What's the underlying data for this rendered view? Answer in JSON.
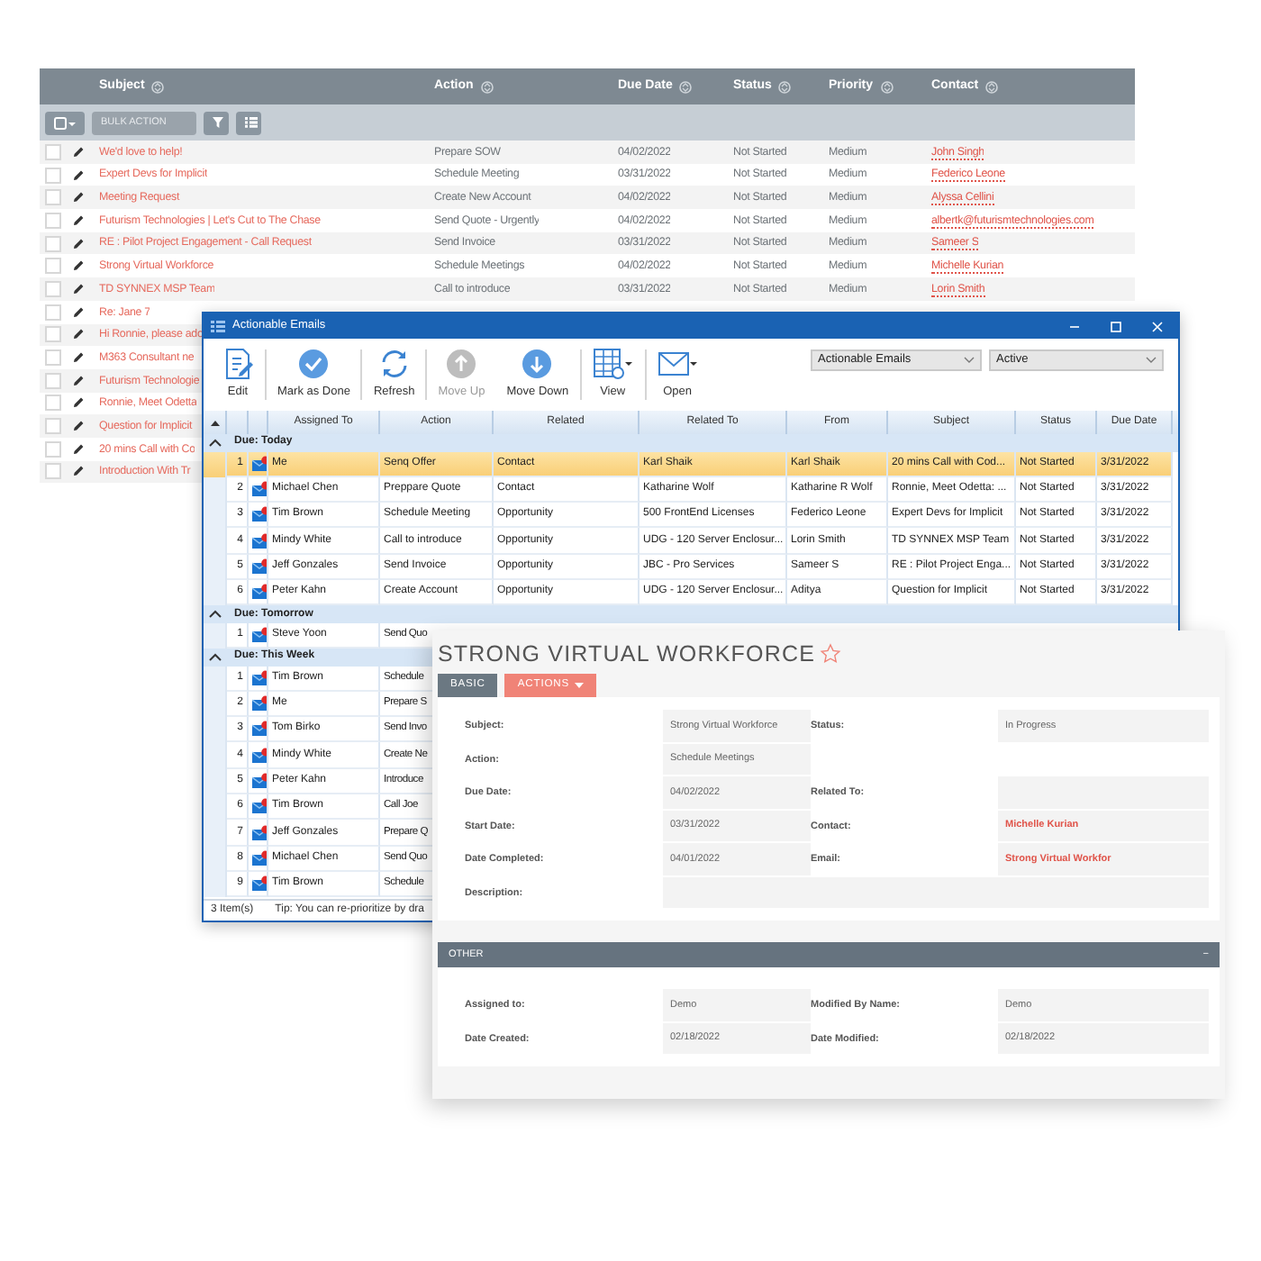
{
  "task_list": {
    "columns": [
      "Subject",
      "Action",
      "Due Date",
      "Status",
      "Priority",
      "Contact"
    ],
    "toolbar": {
      "bulk_action": "BULK ACTION",
      "bulk_disabled": true
    },
    "rows": [
      {
        "checked": false,
        "subject": "We'd love to help!",
        "action": "Prepare SOW",
        "due_date": "04/02/2022",
        "status": "Not Started",
        "priority": "Medium",
        "contact": "John Singh"
      },
      {
        "checked": false,
        "subject": "Expert Devs for Implicit",
        "action": "Schedule Meeting",
        "due_date": "03/31/2022",
        "status": "Not Started",
        "priority": "Medium",
        "contact": "Federico Leone"
      },
      {
        "checked": false,
        "subject": "Meeting Request",
        "action": "Create New Account",
        "due_date": "04/02/2022",
        "status": "Not Started",
        "priority": "Medium",
        "contact": "Alyssa Cellini"
      },
      {
        "checked": false,
        "subject": "Futurism Technologies | Let's Cut to The Chase",
        "action": "Send Quote - Urgently",
        "due_date": "04/02/2022",
        "status": "Not Started",
        "priority": "Medium",
        "contact": "albertk@futurismtechnologies.com"
      },
      {
        "checked": false,
        "subject": "RE : Pilot Project Engagement - Call Request",
        "action": "Send Invoice",
        "due_date": "03/31/2022",
        "status": "Not Started",
        "priority": "Medium",
        "contact": "Sameer S"
      },
      {
        "checked": false,
        "subject": "Strong Virtual Workforce",
        "action": "Schedule Meetings",
        "due_date": "04/02/2022",
        "status": "Not Started",
        "priority": "Medium",
        "contact": "Michelle Kurian"
      },
      {
        "checked": false,
        "subject": "TD SYNNEX MSP Team",
        "action": "Call to introduce",
        "due_date": "03/31/2022",
        "status": "Not Started",
        "priority": "Medium",
        "contact": "Lorin Smith"
      },
      {
        "checked": false,
        "subject": "Re: Jane 7"
      },
      {
        "checked": false,
        "subject": "Hi Ronnie, please ado"
      },
      {
        "checked": false,
        "subject": "M363 Consultant ne"
      },
      {
        "checked": false,
        "subject": "Futurism Technologie"
      },
      {
        "checked": false,
        "subject": "Ronnie, Meet Odetta"
      },
      {
        "checked": false,
        "subject": "Question for Implicit"
      },
      {
        "checked": false,
        "subject": "20 mins Call with Co"
      },
      {
        "checked": false,
        "subject": "Introduction With Tr"
      }
    ]
  },
  "emails_window": {
    "title": "Actionable Emails",
    "toolbar": [
      {
        "kind": "edit",
        "label": "Edit",
        "disabled": false
      },
      {
        "kind": "done",
        "label": "Mark as Done",
        "disabled": false
      },
      {
        "kind": "refresh",
        "label": "Refresh",
        "disabled": false
      },
      {
        "kind": "up",
        "label": "Move Up",
        "disabled": true
      },
      {
        "kind": "down",
        "label": "Move Down",
        "disabled": false
      },
      {
        "kind": "view",
        "label": "View",
        "disabled": false
      },
      {
        "kind": "open",
        "label": "Open",
        "disabled": false
      }
    ],
    "filters": [
      "Actionable Emails",
      "Active"
    ],
    "columns": [
      "Assigned To",
      "Action",
      "Related",
      "Related To",
      "From",
      "Subject",
      "Status",
      "Due Date"
    ],
    "groups": [
      {
        "label": "Due: Today",
        "expanded": true,
        "rows": [
          {
            "number": "1",
            "selected": true,
            "assigned_to": "Me",
            "action": "Senq Offer",
            "related": "Contact",
            "related_to": "Karl Shaik",
            "from": "Karl Shaik",
            "subject": "20 mins Call with Cod...",
            "status": "Not Started",
            "due_date": "3/31/2022"
          },
          {
            "number": "2",
            "selected": false,
            "assigned_to": "Michael Chen",
            "action": "Preppare Quote",
            "related": "Contact",
            "related_to": "Katharine Wolf",
            "from": "Katharine R Wolf",
            "subject": "Ronnie, Meet Odetta: ...",
            "status": "Not Started",
            "due_date": "3/31/2022"
          },
          {
            "number": "3",
            "selected": false,
            "assigned_to": "Tim Brown",
            "action": "Schedule Meeting",
            "related": "Opportunity",
            "related_to": "500 FrontEnd Licenses",
            "from": "Federico Leone",
            "subject": "Expert Devs for Implicit",
            "status": "Not Started",
            "due_date": "3/31/2022"
          },
          {
            "number": "4",
            "selected": false,
            "assigned_to": "Mindy White",
            "action": "Call to introduce",
            "related": "Opportunity",
            "related_to": "UDG - 120 Server Enclosur...",
            "from": "Lorin Smith",
            "subject": "TD SYNNEX MSP Team",
            "status": "Not Started",
            "due_date": "3/31/2022"
          },
          {
            "number": "5",
            "selected": false,
            "assigned_to": "Jeff Gonzales",
            "action": "Send Invoice",
            "related": "Opportunity",
            "related_to": "JBC - Pro Services",
            "from": "Sameer S",
            "subject": "RE : Pilot Project Enga...",
            "status": "Not Started",
            "due_date": "3/31/2022"
          },
          {
            "number": "6",
            "selected": false,
            "assigned_to": "Peter Kahn",
            "action": "Create Account",
            "related": "Opportunity",
            "related_to": "UDG - 120 Server Enclosur...",
            "from": "Aditya",
            "subject": "Question for Implicit",
            "status": "Not Started",
            "due_date": "3/31/2022"
          }
        ]
      },
      {
        "label": "Due: Tomorrow",
        "expanded": true,
        "rows": [
          {
            "number": "1",
            "selected": false,
            "assigned_to": "Steve Yoon",
            "action": "Send Quo"
          }
        ]
      },
      {
        "label": "Due: This Week",
        "expanded": true,
        "rows": [
          {
            "number": "1",
            "selected": false,
            "assigned_to": "Tim Brown",
            "action": "Schedule"
          },
          {
            "number": "2",
            "selected": false,
            "assigned_to": "Me",
            "action": "Prepare S"
          },
          {
            "number": "3",
            "selected": false,
            "assigned_to": "Tom Birko",
            "action": "Send Invo"
          },
          {
            "number": "4",
            "selected": false,
            "assigned_to": "Mindy White",
            "action": "Create Ne"
          },
          {
            "number": "5",
            "selected": false,
            "assigned_to": "Peter Kahn",
            "action": "Introduce"
          },
          {
            "number": "6",
            "selected": false,
            "assigned_to": "Tim Brown",
            "action": "Call Joe"
          },
          {
            "number": "7",
            "selected": false,
            "assigned_to": "Jeff Gonzales",
            "action": "Prepare Q"
          },
          {
            "number": "8",
            "selected": false,
            "assigned_to": "Michael Chen",
            "action": "Send Quo"
          },
          {
            "number": "9",
            "selected": false,
            "assigned_to": "Tim Brown",
            "action": "Schedule"
          }
        ]
      }
    ],
    "status_bar": {
      "count": "3 Item(s)",
      "tip": "Tip: You can re-prioritize by dra"
    }
  },
  "detail": {
    "title": "STRONG VIRTUAL WORKFORCE",
    "starred": false,
    "tabs": [
      {
        "label": "BASIC",
        "selected": true,
        "has_menu": false
      },
      {
        "label": "ACTIONS",
        "selected": false,
        "has_menu": true
      }
    ],
    "rows": [
      [
        {
          "label": "Subject:",
          "value": "Strong Virtual Workforce",
          "kind": "text"
        },
        {
          "label": "Status:",
          "value": "In Progress",
          "kind": "text"
        }
      ],
      [
        {
          "label": "Action:",
          "value": "Schedule Meetings",
          "kind": "text"
        }
      ],
      [
        {
          "label": "Due Date:",
          "value": "04/02/2022",
          "kind": "text"
        },
        {
          "label": "Related To:",
          "kind": "text"
        }
      ],
      [
        {
          "label": "Start Date:",
          "value": "03/31/2022",
          "kind": "text"
        },
        {
          "label": "Contact:",
          "value": "Michelle Kurian",
          "kind": "link"
        }
      ],
      [
        {
          "label": "Date Completed:",
          "value": "04/01/2022",
          "kind": "text"
        },
        {
          "label": "Email:",
          "value": "Strong Virtual Workfor",
          "kind": "link"
        }
      ],
      [
        {
          "label": "Description:",
          "kind": "wide"
        }
      ]
    ],
    "other": {
      "header": "OTHER",
      "collapse": "−",
      "rows": [
        [
          {
            "label": "Assigned to:",
            "value": "Demo",
            "kind": "text"
          },
          {
            "label": "Modified By Name:",
            "value": "Demo",
            "kind": "text"
          }
        ],
        [
          {
            "label": "Date Created:",
            "value": "02/18/2022",
            "kind": "text"
          },
          {
            "label": "Date Modified:",
            "value": "02/18/2022",
            "kind": "text"
          }
        ]
      ]
    }
  }
}
